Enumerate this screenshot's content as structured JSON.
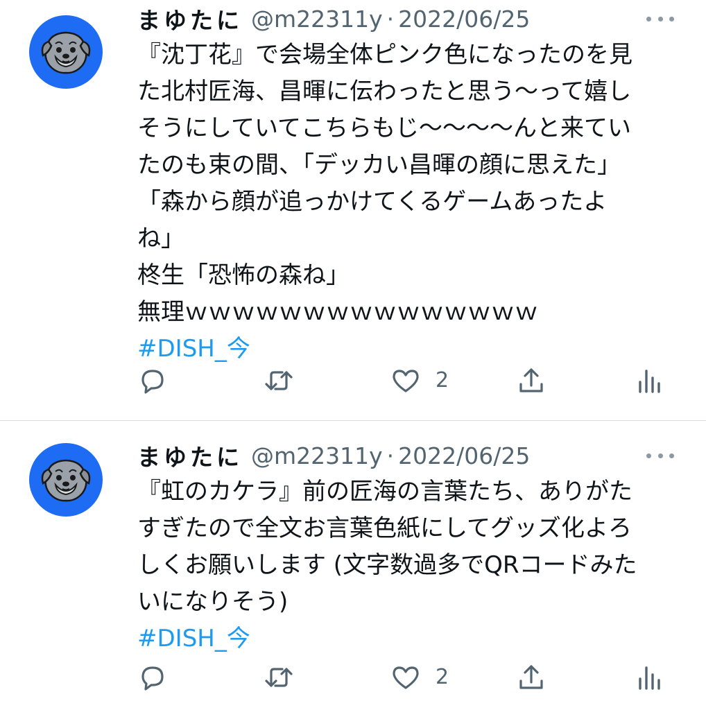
{
  "tweets": [
    {
      "author": {
        "name": "まゆたに",
        "handle": "@m22311y",
        "avatar_icon": "dog-avatar-icon",
        "avatar_color": "#1d6cf3"
      },
      "separator": "·",
      "date": "2022/06/25",
      "lines": [
        "『沈丁花』で会場全体ピンク色になったのを見",
        "た北村匠海、昌暉に伝わったと思う〜って嬉し",
        "そうにしていてこちらもじ〜〜〜〜んと来てい",
        "たのも束の間、「デッカい昌暉の顔に思えた」",
        "「森から顔が追っかけてくるゲームあったよ",
        "ね」",
        "柊生「恐怖の森ね」",
        "無理ｗｗｗｗｗｗｗｗｗｗｗｗｗｗｗ"
      ],
      "hashtag": "#DISH_今",
      "actions": {
        "reply": "reply-icon",
        "retweet": "retweet-icon",
        "like": "heart-icon",
        "like_count": "2",
        "share": "share-icon",
        "analytics": "analytics-icon"
      }
    },
    {
      "author": {
        "name": "まゆたに",
        "handle": "@m22311y",
        "avatar_icon": "dog-avatar-icon",
        "avatar_color": "#1d6cf3"
      },
      "separator": "·",
      "date": "2022/06/25",
      "lines": [
        "『虹のカケラ』前の匠海の言葉たち、ありがた",
        "すぎたので全文お言葉色紙にしてグッズ化よろ",
        "しくお願いします (文字数過多でQRコードみた",
        "いになりそう)"
      ],
      "hashtag": "#DISH_今",
      "actions": {
        "reply": "reply-icon",
        "retweet": "retweet-icon",
        "like": "heart-icon",
        "like_count": "2",
        "share": "share-icon",
        "analytics": "analytics-icon"
      }
    }
  ],
  "colors": {
    "text": "#0f1419",
    "secondary": "#536471",
    "link": "#1d9bf0",
    "divider": "#d9dde1"
  }
}
